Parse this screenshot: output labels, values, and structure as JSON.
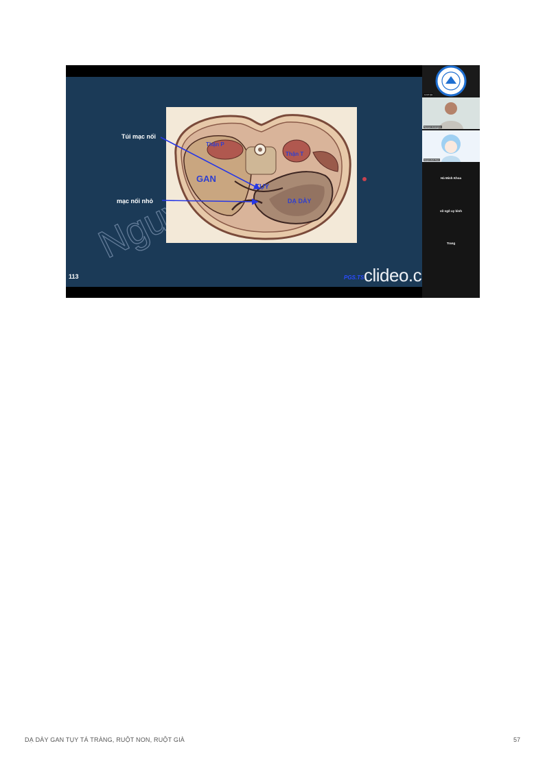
{
  "slide": {
    "labels": {
      "tui_mac_noi": "Túi mạc nối",
      "mac_noi_nho": "mạc nối nhỏ"
    },
    "organs": {
      "gan": "GAN",
      "tuy": "TỤY",
      "da_day": "DẠ DÀY",
      "than_p": "Thận P",
      "than_t": "Thận T"
    },
    "watermark": "Nguyễn Vu",
    "slide_number": "113",
    "credit": "PGS.TS",
    "brand": "clideo.com"
  },
  "participants": {
    "tile_names": [
      "Lmsh Qa",
      "Nguyen Hoangson",
      "Huyen Anh Tran"
    ],
    "names": [
      "Hà Minh Khoa",
      "vũ ngô uy bình",
      "Trang"
    ]
  },
  "footer": {
    "text": "DẠ DÀY GAN TỤY TÁ TRÀNG, RUỘT NON, RUỘT GIÀ",
    "page": "57"
  },
  "colors": {
    "slide_bg": "#1b3a57",
    "arrow": "#2637e6",
    "organ_label": "#2f3fd0",
    "tissue": "#f3e9d8"
  }
}
